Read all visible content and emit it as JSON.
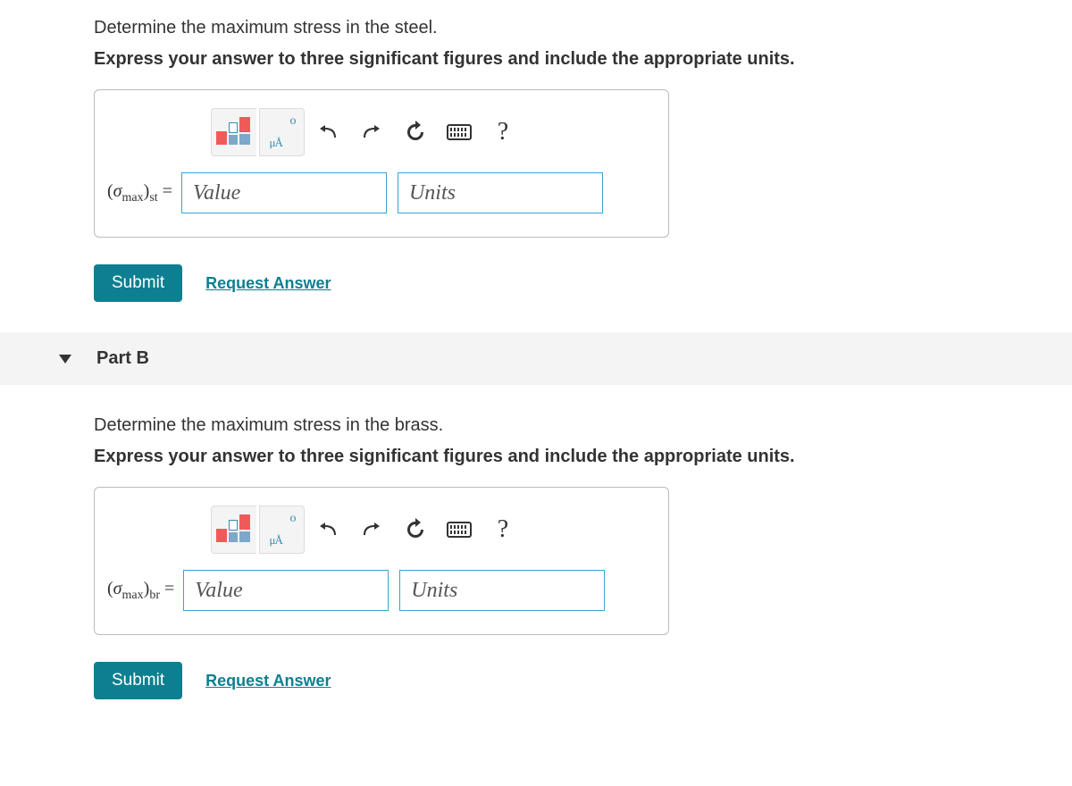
{
  "partA": {
    "prompt": "Determine the maximum stress in the steel.",
    "instruction": "Express your answer to three significant figures and include the appropriate units.",
    "variable_html": "(<span class='sigma'>σ</span><span class='sub'>max</span>)<span class='sub'>st</span> =",
    "value_placeholder": "Value",
    "units_placeholder": "Units",
    "submit_label": "Submit",
    "request_label": "Request Answer",
    "help_label": "?"
  },
  "partB_header": "Part B",
  "partB": {
    "prompt": "Determine the maximum stress in the brass.",
    "instruction": "Express your answer to three significant figures and include the appropriate units.",
    "variable_html": "(<span class='sigma'>σ</span><span class='sub'>max</span>)<span class='sub'>br</span> =",
    "value_placeholder": "Value",
    "units_placeholder": "Units",
    "submit_label": "Submit",
    "request_label": "Request Answer",
    "help_label": "?"
  }
}
